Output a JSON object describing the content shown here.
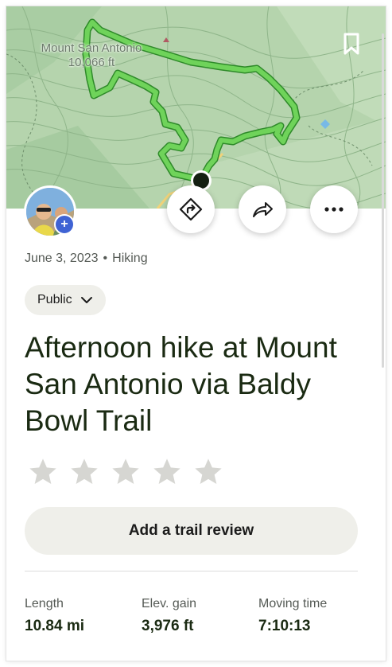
{
  "map": {
    "peak_name": "Mount San Antonio",
    "peak_elevation": "10,066 ft"
  },
  "activity": {
    "date": "June 3, 2023",
    "separator": "•",
    "type": "Hiking",
    "visibility": "Public",
    "title": "Afternoon hike at Mount San Antonio via Baldy Bowl Trail",
    "rating": {
      "value": 0,
      "max": 5
    },
    "review_button": "Add a trail review"
  },
  "stats": [
    {
      "label": "Length",
      "value": "10.84 mi"
    },
    {
      "label": "Elev. gain",
      "value": "3,976 ft"
    },
    {
      "label": "Moving time",
      "value": "7:10:13"
    }
  ],
  "colors": {
    "route": "#6fd35a",
    "badge": "#3f63d4",
    "title_text": "#1a2a12",
    "pill_bg": "#efefea",
    "star": "#d6d6d2"
  },
  "icons": [
    "bookmark-icon",
    "directions-icon",
    "share-icon",
    "more-icon",
    "chevron-down-icon",
    "star-icon",
    "plus-icon"
  ]
}
